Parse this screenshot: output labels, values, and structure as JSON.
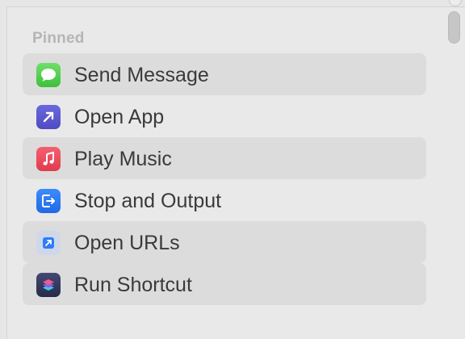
{
  "section": {
    "title": "Pinned"
  },
  "actions": [
    {
      "label": "Send Message",
      "icon": "message-bubble-icon",
      "color": "#5bd25a"
    },
    {
      "label": "Open App",
      "icon": "arrow-up-right-icon",
      "color": "#5e5ccf"
    },
    {
      "label": "Play Music",
      "icon": "music-note-icon",
      "color": "#ec4b5e"
    },
    {
      "label": "Stop and Output",
      "icon": "exit-output-icon",
      "color": "#2f7cf6"
    },
    {
      "label": "Open URLs",
      "icon": "link-arrow-icon",
      "color": "#2f7cf6"
    },
    {
      "label": "Run Shortcut",
      "icon": "shortcuts-icon",
      "color": "#3a3f66"
    }
  ]
}
